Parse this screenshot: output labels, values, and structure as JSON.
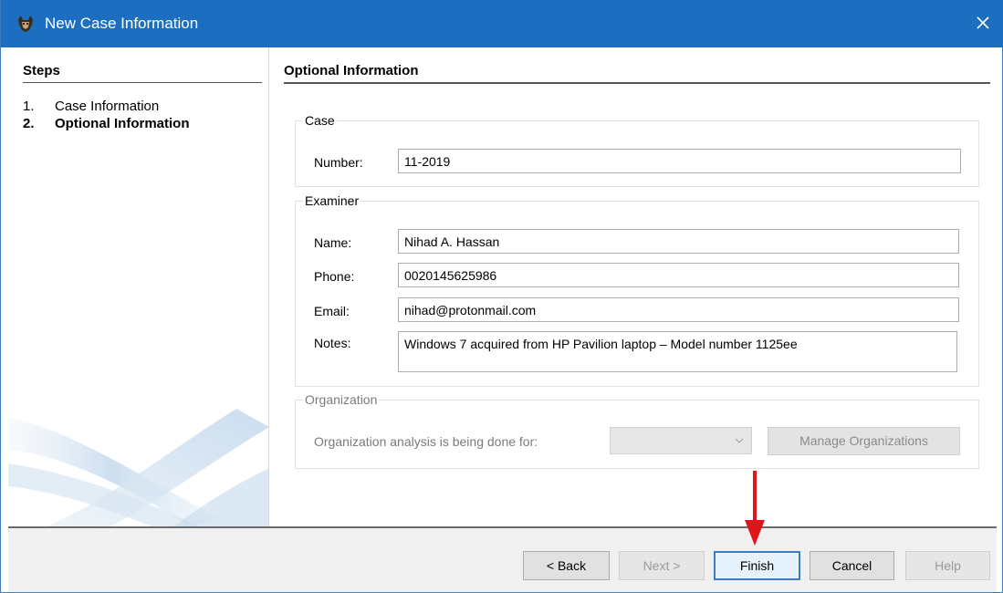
{
  "window": {
    "title": "New Case Information"
  },
  "steps": {
    "header": "Steps",
    "items": [
      {
        "num": "1.",
        "label": "Case Information"
      },
      {
        "num": "2.",
        "label": "Optional Information"
      }
    ]
  },
  "content": {
    "header": "Optional Information",
    "case": {
      "legend": "Case",
      "number_label": "Number:",
      "number_value": "11-2019"
    },
    "examiner": {
      "legend": "Examiner",
      "name_label": "Name:",
      "name_value": "Nihad A. Hassan",
      "phone_label": "Phone:",
      "phone_value": "0020145625986",
      "email_label": "Email:",
      "email_value": "nihad@protonmail.com",
      "notes_label": "Notes:",
      "notes_value": "Windows 7 acquired from HP Pavilion laptop – Model number 1125ee"
    },
    "organization": {
      "legend": "Organization",
      "prompt": "Organization analysis is being done for:",
      "selected": "",
      "manage_label": "Manage Organizations"
    }
  },
  "buttons": {
    "back": "< Back",
    "next": "Next >",
    "finish": "Finish",
    "cancel": "Cancel",
    "help": "Help"
  },
  "colors": {
    "titlebar": "#1c6fc0",
    "annotation_arrow": "#e0151b",
    "primary_border": "#3c7dc4"
  },
  "icons": {
    "app": "autopsy-dog-icon",
    "close": "close-icon",
    "dropdown": "chevron-down-icon",
    "annotation": "red-arrow-annotation"
  }
}
